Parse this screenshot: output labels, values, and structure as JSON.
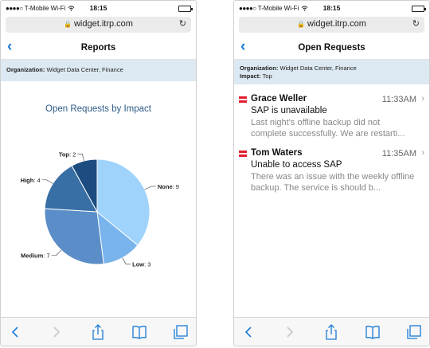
{
  "status_bar": {
    "signal_dots": "●●●●○",
    "carrier": "T-Mobile Wi-Fi",
    "wifi_icon": "wifi-icon",
    "time": "18:15",
    "battery_level": 1.0
  },
  "browser": {
    "url": "widget.itrp.com",
    "lock_icon": "lock-icon",
    "reload_icon": "reload-icon"
  },
  "reports_screen": {
    "title": "Reports",
    "back_icon": "chevron-left-icon",
    "organization_label": "Organization:",
    "organization_value": "Widget Data Center, Finance",
    "chart_title": "Open Requests by Impact"
  },
  "chart_data": {
    "type": "pie",
    "title": "Open Requests by Impact",
    "categories": [
      "None",
      "Low",
      "Medium",
      "High",
      "Top"
    ],
    "values": [
      9,
      3,
      7,
      4,
      2
    ],
    "colors": [
      "#9fd3fc",
      "#79b4ec",
      "#5b8ec8",
      "#386fa5",
      "#1c4c80"
    ],
    "labels": [
      "None: 9",
      "Low: 3",
      "Medium: 7",
      "High: 4",
      "Top: 2"
    ]
  },
  "requests_screen": {
    "title": "Open Requests",
    "back_icon": "chevron-left-icon",
    "organization_label": "Organization:",
    "organization_value": "Widget Data Center, Finance",
    "impact_label": "Impact:",
    "impact_value": "Top",
    "messages": [
      {
        "from": "Grace Weller",
        "time": "11:33AM",
        "subject": "SAP is unavailable",
        "preview": "Last night's offline backup did not complete successfully. We are restarti...",
        "priority_color": "#e01f2e"
      },
      {
        "from": "Tom Waters",
        "time": "11:35AM",
        "subject": "Unable to access SAP",
        "preview": "There was an issue with the weekly offline backup. The service is should b...",
        "priority_color": "#e01f2e"
      }
    ]
  },
  "toolbar": {
    "icons": [
      "back-icon",
      "forward-icon",
      "share-icon",
      "bookmarks-icon",
      "tabs-icon"
    ]
  }
}
